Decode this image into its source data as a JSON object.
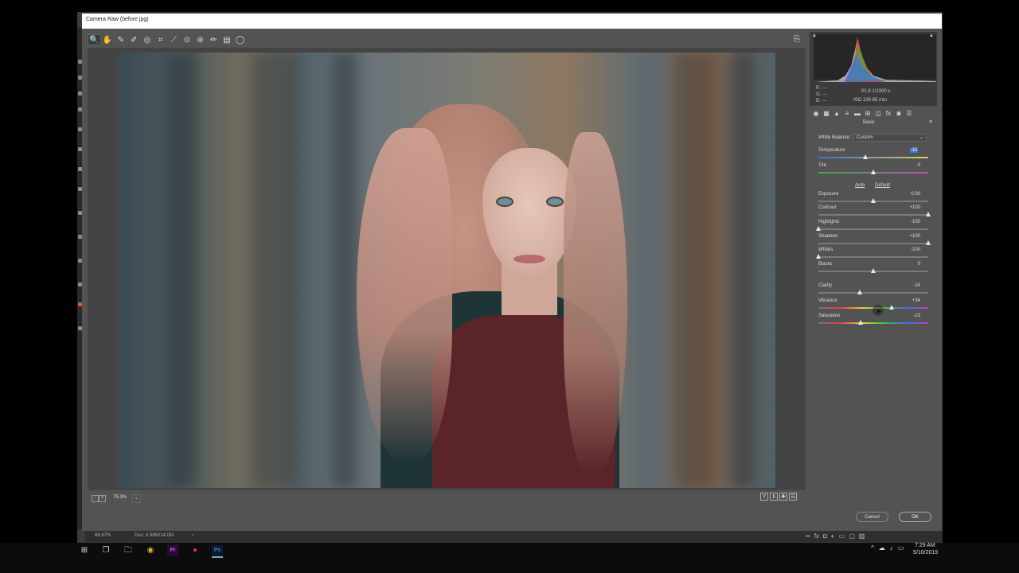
{
  "window": {
    "title": "Camera Raw (before.jpg)"
  },
  "toolbar": {
    "tools": [
      {
        "name": "zoom-tool",
        "glyph": "🔍"
      },
      {
        "name": "hand-tool",
        "glyph": "✋"
      },
      {
        "name": "white-balance-tool",
        "glyph": "✎"
      },
      {
        "name": "color-sampler-tool",
        "glyph": "✐"
      },
      {
        "name": "targeted-adjustment-tool",
        "glyph": "◎"
      },
      {
        "name": "crop-tool",
        "glyph": "⌗"
      },
      {
        "name": "straighten-tool",
        "glyph": "⟋"
      },
      {
        "name": "spot-removal-tool",
        "glyph": "⊙"
      },
      {
        "name": "red-eye-tool",
        "glyph": "⊛"
      },
      {
        "name": "adjustment-brush-tool",
        "glyph": "✏"
      },
      {
        "name": "graduated-filter-tool",
        "glyph": "▤"
      },
      {
        "name": "radial-filter-tool",
        "glyph": "◯"
      }
    ],
    "open_preferences": "⎘"
  },
  "preview": {
    "zoom_minus": "-",
    "zoom_plus": "+",
    "zoom_value": "75.3%",
    "zoom_dropdown": "⌄",
    "view_buttons": [
      "Y",
      "⇕",
      "✚",
      "☰"
    ]
  },
  "histogram": {
    "clip_left": "▲",
    "clip_right": "▲",
    "r": "R:   ---",
    "g": "G:   ---",
    "b": "B:   ---",
    "camera_line1": "f/1.8    1/1000 s",
    "camera_line2": "ISO 100    85 mm"
  },
  "panel_tabs": [
    "◉",
    "▦",
    "▲",
    "≡",
    "▬",
    "⊞",
    "◫",
    "fx",
    "◙",
    "☰"
  ],
  "basic_panel": {
    "name": "Basic",
    "menu": "≡",
    "white_balance_label": "White Balance:",
    "white_balance_value": "Custom",
    "white_balance_caret": "⌄",
    "auto_label": "Auto",
    "default_label": "Default",
    "sliders": [
      {
        "key": "temperature",
        "label": "Temperature",
        "value": "-15",
        "position": 0.43
      },
      {
        "key": "tint",
        "label": "Tint",
        "value": "0",
        "position": 0.5
      },
      {
        "key": "exposure",
        "label": "Exposure",
        "value": "0.00",
        "position": 0.5
      },
      {
        "key": "contrast",
        "label": "Contrast",
        "value": "+100",
        "position": 1.0
      },
      {
        "key": "highlights",
        "label": "Highlights",
        "value": "-100",
        "position": 0.0
      },
      {
        "key": "shadows",
        "label": "Shadows",
        "value": "+100",
        "position": 1.0
      },
      {
        "key": "whites",
        "label": "Whites",
        "value": "-100",
        "position": 0.0
      },
      {
        "key": "blacks",
        "label": "Blacks",
        "value": "0",
        "position": 0.5
      },
      {
        "key": "clarity",
        "label": "Clarity",
        "value": "-24",
        "position": 0.38
      },
      {
        "key": "vibrance",
        "label": "Vibrance",
        "value": "+34",
        "position": 0.67
      },
      {
        "key": "saturation",
        "label": "Saturation",
        "value": "-23",
        "position": 0.385
      }
    ]
  },
  "dialog_buttons": {
    "cancel": "Cancel",
    "ok": "OK"
  },
  "photoshop_status": {
    "zoom": "66.67%",
    "doc": "Doc: 6.98M/14.0M",
    "arrow": "›"
  },
  "taskbar": {
    "icons": [
      "⊞",
      "❐",
      "🗀",
      "◉",
      "Pr",
      "●",
      "Ps"
    ],
    "tray": [
      "^",
      "☁",
      "♪",
      "▭"
    ],
    "time": "7:29 AM",
    "date": "5/10/2019"
  },
  "colors": {
    "accent": "#3a76d6",
    "panel_bg": "#535353"
  }
}
